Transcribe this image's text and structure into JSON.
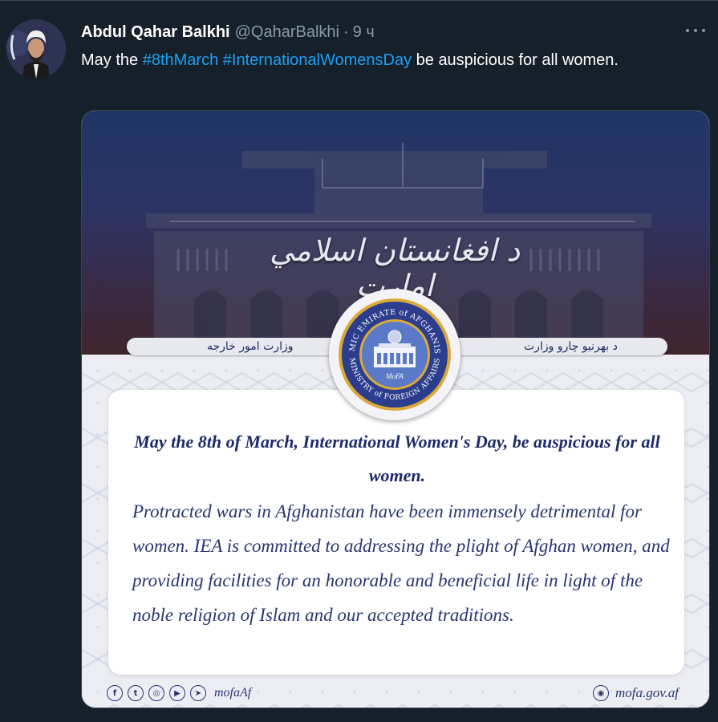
{
  "tweet": {
    "display_name": "Abdul Qahar Balkhi",
    "handle": "@QaharBalkhi",
    "separator": "·",
    "time": "9 ч",
    "text_prefix": "May the ",
    "hashtag_1": "#8thMarch",
    "hashtag_space": " ",
    "hashtag_2": "#InternationalWomensDay",
    "text_suffix": " be auspicious for all women.",
    "more_icon": "more-horizontal-icon"
  },
  "media": {
    "calligraphy": "د افغانستان اسلامي امارت",
    "label_left": "وزارت امور خارجه",
    "label_right": "د بهرنیو چارو وزارت",
    "seal_outer_top": "ISLAMIC EMIRATE of AFGHANISTAN",
    "seal_outer_bottom": "MINISTRY of FOREIGN AFFAIRS",
    "seal_center": "MoFA",
    "headline": "May the 8th of March, International Women's Day, be auspicious for all women.",
    "body": "Protracted wars in Afghanistan have been immensely detrimental for women. IEA is committed to addressing the plight of Afghan women, and providing facilities for an honorable and beneficial life in light of the noble religion of Islam and our accepted traditions.",
    "social_icons": [
      "facebook-icon",
      "twitter-icon",
      "instagram-icon",
      "youtube-icon",
      "telegram-icon"
    ],
    "social_glyphs": [
      "f",
      "t",
      "◎",
      "▶",
      "➤"
    ],
    "social_handle": "mofaAf",
    "website_icon": "globe-icon",
    "website_glyph": "◉",
    "website": "mofa.gov.af"
  },
  "colors": {
    "background": "#15202b",
    "link": "#1da1f2",
    "muted": "#8899a6",
    "navy": "#1d2a68"
  }
}
